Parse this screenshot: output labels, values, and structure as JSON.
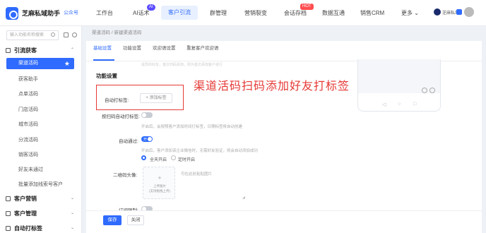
{
  "app": {
    "name": "芝麻私域助手",
    "sub": "公众号"
  },
  "nav": {
    "items": [
      "工作台",
      "AI话术",
      "客户引流",
      "群管理",
      "营销裂变",
      "会话存档",
      "数据互通",
      "销售CRM",
      "更多 ⌄"
    ],
    "active_index": 2,
    "ai_badge": "AI",
    "hot_badge": "HOT"
  },
  "user": {
    "name": "芝麻私域"
  },
  "sidebar": {
    "search_placeholder": "输入功能名称搜索",
    "groups": [
      {
        "label": "引流获客",
        "caret": "⌃"
      },
      {
        "label": "客户营销",
        "caret": "⌄"
      },
      {
        "label": "客户管理",
        "caret": "⌄"
      },
      {
        "label": "自动打标签",
        "caret": "⌄"
      }
    ],
    "items": [
      "渠道活码",
      "获客助手",
      "点单活码",
      "门店活码",
      "城市活码",
      "分流活码",
      "销客活码",
      "好友未通过",
      "批量添加线索号客户"
    ]
  },
  "breadcrumb": {
    "parent": "渠道活码",
    "sep": "/",
    "current": "新建渠道活码"
  },
  "tabs": [
    "基础设置",
    "功能设置",
    "欢迎语设置",
    "重复客户欢迎语"
  ],
  "faded_line": "成员的好友，首次扫码添加，则为首次添加客户进行",
  "form": {
    "section_title": "功能设置",
    "auto_tag_label": "自动打标签:",
    "add_tag": "+ 添加标签",
    "scan_tag_label": "按扫码自动打标签:",
    "scan_tag_hint": "开启后，会按照客户添加时间打标签，日期标签将自动创建",
    "auto_pass_label": "自动通过:",
    "auto_pass_on": "开",
    "auto_pass_hint": "开启后，客户添加该企业微信时，无需好友验证，将会自动添加成功",
    "radio_all_day": "全天开启",
    "radio_scheduled": "定时开启",
    "qr_avatar_label": "二维码头像:",
    "upload_title": "上传图片",
    "upload_sub": "(支持拖拽上传)",
    "upload_hint": "可在此处粘贴图片",
    "limit_label": "订阅限制:"
  },
  "annotation": "渠道活码扫码添加好友打标签",
  "buttons": {
    "save": "保存",
    "close": "关闭"
  },
  "phone": {
    "nav_back": "◁",
    "nav_home": "○",
    "nav_recent": "□"
  }
}
